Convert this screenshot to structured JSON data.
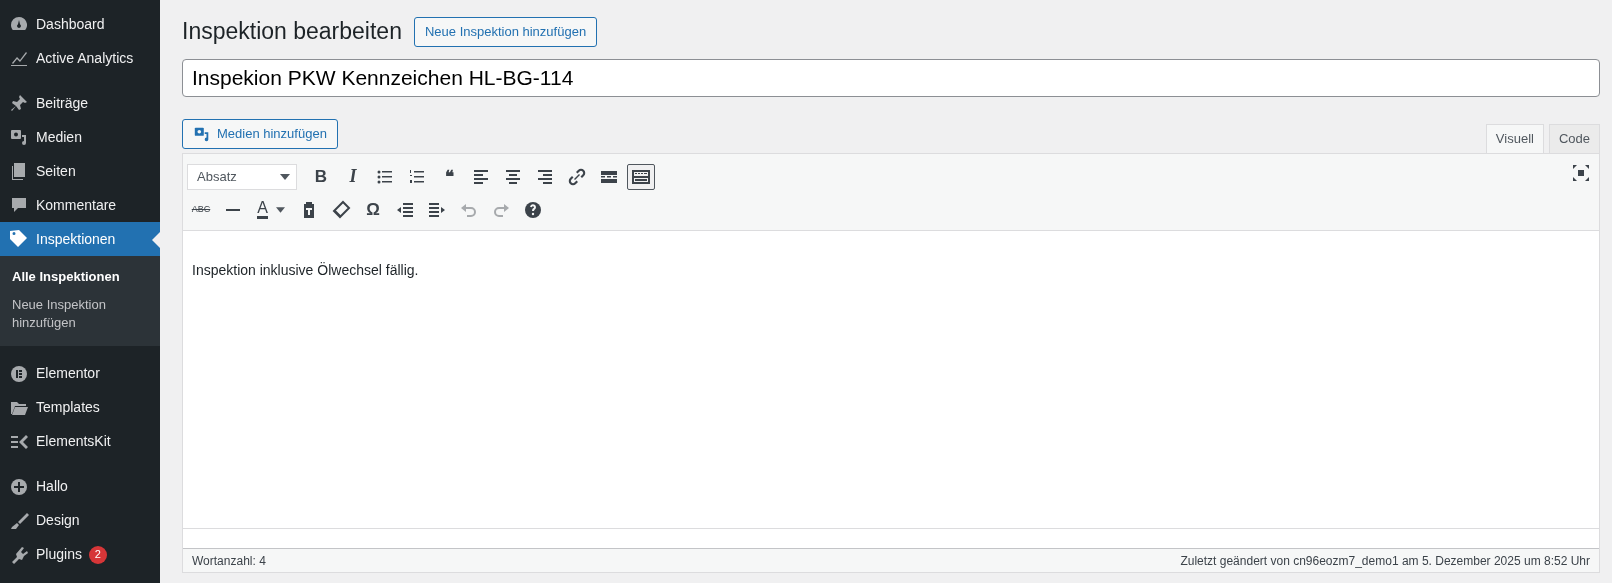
{
  "sidebar": {
    "groups": [
      [
        {
          "label": "Dashboard",
          "selected": false
        },
        {
          "label": "Active Analytics",
          "selected": false
        }
      ],
      [
        {
          "label": "Beiträge",
          "selected": false
        },
        {
          "label": "Medien",
          "selected": false
        },
        {
          "label": "Seiten",
          "selected": false
        },
        {
          "label": "Kommentare",
          "selected": false
        },
        {
          "label": "Inspektionen",
          "selected": true,
          "children": [
            {
              "label": "Alle Inspektionen",
              "selected": true
            },
            {
              "label": "Neue Inspektion hinzufügen",
              "selected": false
            }
          ]
        }
      ],
      [
        {
          "label": "Elementor",
          "selected": false
        },
        {
          "label": "Templates",
          "selected": false
        },
        {
          "label": "ElementsKit",
          "selected": false
        }
      ],
      [
        {
          "label": "Hallo",
          "selected": false
        },
        {
          "label": "Design",
          "selected": false
        },
        {
          "label": "Plugins",
          "selected": false,
          "badge": "2"
        }
      ]
    ]
  },
  "page_title": "Inspektion bearbeiten",
  "add_new_button": "Neue Inspektion hinzufügen",
  "title_field": {
    "value": "Inspekion PKW Kennzeichen HL-BG-114"
  },
  "media_button": "Medien hinzufügen",
  "editor_tabs": [
    {
      "label": "Visuell",
      "selected": true
    },
    {
      "label": "Code",
      "selected": false
    }
  ],
  "toolbar_rows": [
    [
      {
        "kind": "select",
        "value": "Absatz"
      },
      {
        "kind": "glyph",
        "glyph": "B",
        "disabled": false,
        "active": false
      },
      {
        "kind": "glyph",
        "glyph": "I",
        "disabled": false,
        "active": false
      },
      {
        "kind": "icon",
        "disabled": false,
        "active": false
      },
      {
        "kind": "icon",
        "disabled": false,
        "active": false
      },
      {
        "kind": "glyph",
        "glyph": "❝",
        "disabled": false,
        "active": false
      },
      {
        "kind": "icon",
        "disabled": false,
        "active": false
      },
      {
        "kind": "icon",
        "disabled": false,
        "active": false
      },
      {
        "kind": "icon",
        "disabled": false,
        "active": false
      },
      {
        "kind": "icon",
        "disabled": false,
        "active": false
      },
      {
        "kind": "icon",
        "disabled": false,
        "active": false
      },
      {
        "kind": "icon",
        "disabled": false,
        "active": true
      }
    ],
    [
      {
        "kind": "glyph",
        "glyph": "ABC",
        "disabled": false,
        "active": false
      },
      {
        "kind": "icon",
        "disabled": false,
        "active": false
      },
      {
        "kind": "color",
        "glyph": "A",
        "disabled": false,
        "active": false
      },
      {
        "kind": "icon",
        "disabled": false,
        "active": false
      },
      {
        "kind": "icon",
        "disabled": false,
        "active": false
      },
      {
        "kind": "glyph",
        "glyph": "Ω",
        "disabled": false,
        "active": false
      },
      {
        "kind": "icon",
        "disabled": false,
        "active": false
      },
      {
        "kind": "icon",
        "disabled": false,
        "active": false
      },
      {
        "kind": "icon",
        "disabled": true,
        "active": false
      },
      {
        "kind": "icon",
        "disabled": true,
        "active": false
      },
      {
        "kind": "icon",
        "disabled": false,
        "active": false
      }
    ]
  ],
  "content": "Inspektion inklusive Ölwechsel fällig.",
  "status_bar": {
    "word_count": "Wortanzahl: 4",
    "last_edited": "Zuletzt geändert von cn96eozm7_demo1 am 5. Dezember 2025 um 8:52 Uhr"
  }
}
